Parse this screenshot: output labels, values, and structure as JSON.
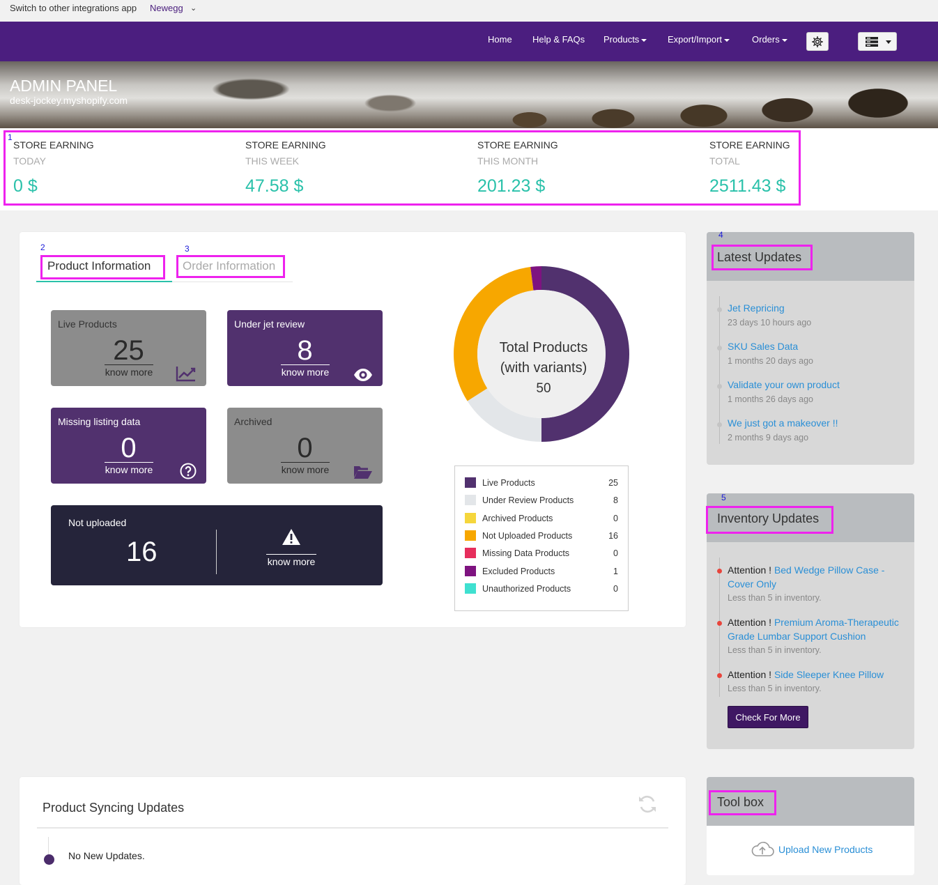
{
  "switchbar": {
    "label": "Switch to other integrations app",
    "selected": "Newegg"
  },
  "nav": {
    "items": [
      {
        "label": "Home",
        "dropdown": false
      },
      {
        "label": "Help & FAQs",
        "dropdown": false
      },
      {
        "label": "Products",
        "dropdown": true
      },
      {
        "label": "Export/Import",
        "dropdown": true
      },
      {
        "label": "Orders",
        "dropdown": true
      }
    ],
    "settings_icon": "gear-icon",
    "menu_icon": "server-stack-icon"
  },
  "banner": {
    "title": "ADMIN PANEL",
    "subtitle": "desk-jockey.myshopify.com"
  },
  "earnings": [
    {
      "line1": "STORE EARNING",
      "line2": "TODAY",
      "value": "0 $"
    },
    {
      "line1": "STORE EARNING",
      "line2": "THIS WEEK",
      "value": "47.58 $"
    },
    {
      "line1": "STORE EARNING",
      "line2": "THIS MONTH",
      "value": "201.23 $"
    },
    {
      "line1": "STORE EARNING",
      "line2": "TOTAL",
      "value": "2511.43 $"
    }
  ],
  "annotations": [
    "1",
    "2",
    "3",
    "4",
    "5"
  ],
  "tabs": [
    {
      "label": "Product Information",
      "active": true
    },
    {
      "label": "Order Information",
      "active": false
    }
  ],
  "tiles": {
    "live": {
      "label": "Live Products",
      "value": "25",
      "more": "know more",
      "icon": "chart-trend-icon"
    },
    "review": {
      "label": "Under jet review",
      "value": "8",
      "more": "know more",
      "icon": "eye-icon"
    },
    "missing": {
      "label": "Missing listing data",
      "value": "0",
      "more": "know more",
      "icon": "question-circle-icon"
    },
    "archived": {
      "label": "Archived",
      "value": "0",
      "more": "know more",
      "icon": "folder-open-icon"
    },
    "not_uploaded": {
      "label": "Not uploaded",
      "value": "16",
      "more": "know more",
      "icon": "warning-icon"
    }
  },
  "donut": {
    "line1": "Total Products",
    "line2": "(with variants)",
    "total": "50"
  },
  "chart_data": {
    "type": "pie",
    "categories": [
      "Live Products",
      "Under Review Products",
      "Archived Products",
      "Not Uploaded Products",
      "Missing Data Products",
      "Excluded Products",
      "Unauthorized Products"
    ],
    "values": [
      25,
      8,
      0,
      16,
      0,
      1,
      0
    ],
    "colors": [
      "#51316e",
      "#e3e6e9",
      "#f5d63c",
      "#f7a700",
      "#e62e5c",
      "#7e1380",
      "#3fe0d0"
    ],
    "title": "",
    "legend": "bottom"
  },
  "latest_updates": {
    "title": "Latest Updates",
    "items": [
      {
        "title": "Jet Repricing",
        "time": "23 days 10 hours ago"
      },
      {
        "title": "SKU Sales Data",
        "time": "1 months 20 days ago"
      },
      {
        "title": "Validate your own product",
        "time": "1 months 26 days ago"
      },
      {
        "title": "We just got a makeover !!",
        "time": "2 months 9 days ago"
      }
    ]
  },
  "inventory_updates": {
    "title": "Inventory Updates",
    "attention_label": "Attention !",
    "items": [
      {
        "product": "Bed Wedge Pillow Case - Cover Only",
        "note": "Less than 5 in inventory."
      },
      {
        "product": "Premium Aroma-Therapeutic Grade Lumbar Support Cushion",
        "note": "Less than 5 in inventory."
      },
      {
        "product": "Side Sleeper Knee Pillow",
        "note": "Less than 5 in inventory."
      }
    ],
    "button": "Check For More"
  },
  "sync": {
    "title": "Product Syncing Updates",
    "message": "No New Updates.",
    "refresh_icon": "refresh-icon"
  },
  "toolbox": {
    "title": "Tool box",
    "link": "Upload New Products",
    "icon": "cloud-upload-icon"
  }
}
